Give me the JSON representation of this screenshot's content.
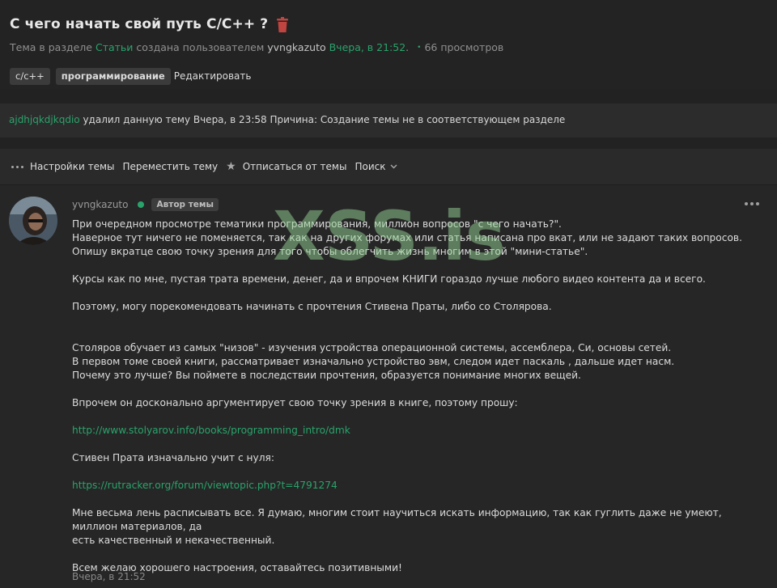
{
  "thread": {
    "title": "С чего начать свой путь С/С++ ?",
    "meta_prefix": "Тема в разделе",
    "section": "Статьи",
    "meta_mid": "создана пользователем",
    "author": "yvngkazuto",
    "created": "Вчера, в 21:52",
    "period": ".",
    "views": "66 просмотров",
    "tags": [
      "c/c++",
      "программирование"
    ],
    "edit_label": "Редактировать"
  },
  "notice": {
    "user": "ajdhjqkdjkqdio",
    "text": "удалил данную тему Вчера, в 23:58 Причина: Создание темы не в соответствующем разделе"
  },
  "toolbar": {
    "settings": "Настройки темы",
    "move": "Переместить тему",
    "unsubscribe": "Отписаться от темы",
    "search": "Поиск"
  },
  "post": {
    "author": "yvngkazuto",
    "badge": "Автор темы",
    "p1": "При очередном просмотре тематики программирования, миллион вопросов \"с чего начать?\".\nНаверное тут ничего не поменяется, так как на других форумах или статья написана про вкат, или не задают таких вопросов.\nОпишу вкратце свою точку зрения для того чтобы облегчить жизнь многим в этой \"мини-статье\".",
    "p2": "Курсы как по мне, пустая трата времени, денег, да и впрочем КНИГИ гораздо лучше любого видео контента да и всего.",
    "p3": "Поэтому, могу порекомендовать начинать с прочтения Стивена Праты, либо со Столярова.",
    "p4": "Столяров обучает из самых \"низов\" - изучения устройства операционной системы, ассемблера, Си, основы сетей.\nВ первом томе своей книги, рассматривает изначально устройство эвм, следом идет паскаль , дальше идет насм.\nПочему это лучше? Вы поймете в последствии прочтения, образуется понимание многих вещей.",
    "p5": "Впрочем он досконально аргументирует свою точку зрения в книге, поэтому прошу:",
    "link1": "http://www.stolyarov.info/books/programming_intro/dmk",
    "p6": "Стивен Прата изначально учит с нуля:",
    "link2": "https://rutracker.org/forum/viewtopic.php?t=4791274",
    "p7": "Мне весьма лень расписывать все. Я думаю, многим стоит научиться искать информацию, так как гуглить даже не умеют, миллион материалов, да\nесть качественный и некачественный.",
    "p8": "Всем желаю хорошего настроения, оставайтесь позитивными!",
    "time": "Вчера, в 21:52"
  },
  "watermark": "XSS.is",
  "colors": {
    "accent": "#2aa36b",
    "delete": "#c0443f"
  }
}
